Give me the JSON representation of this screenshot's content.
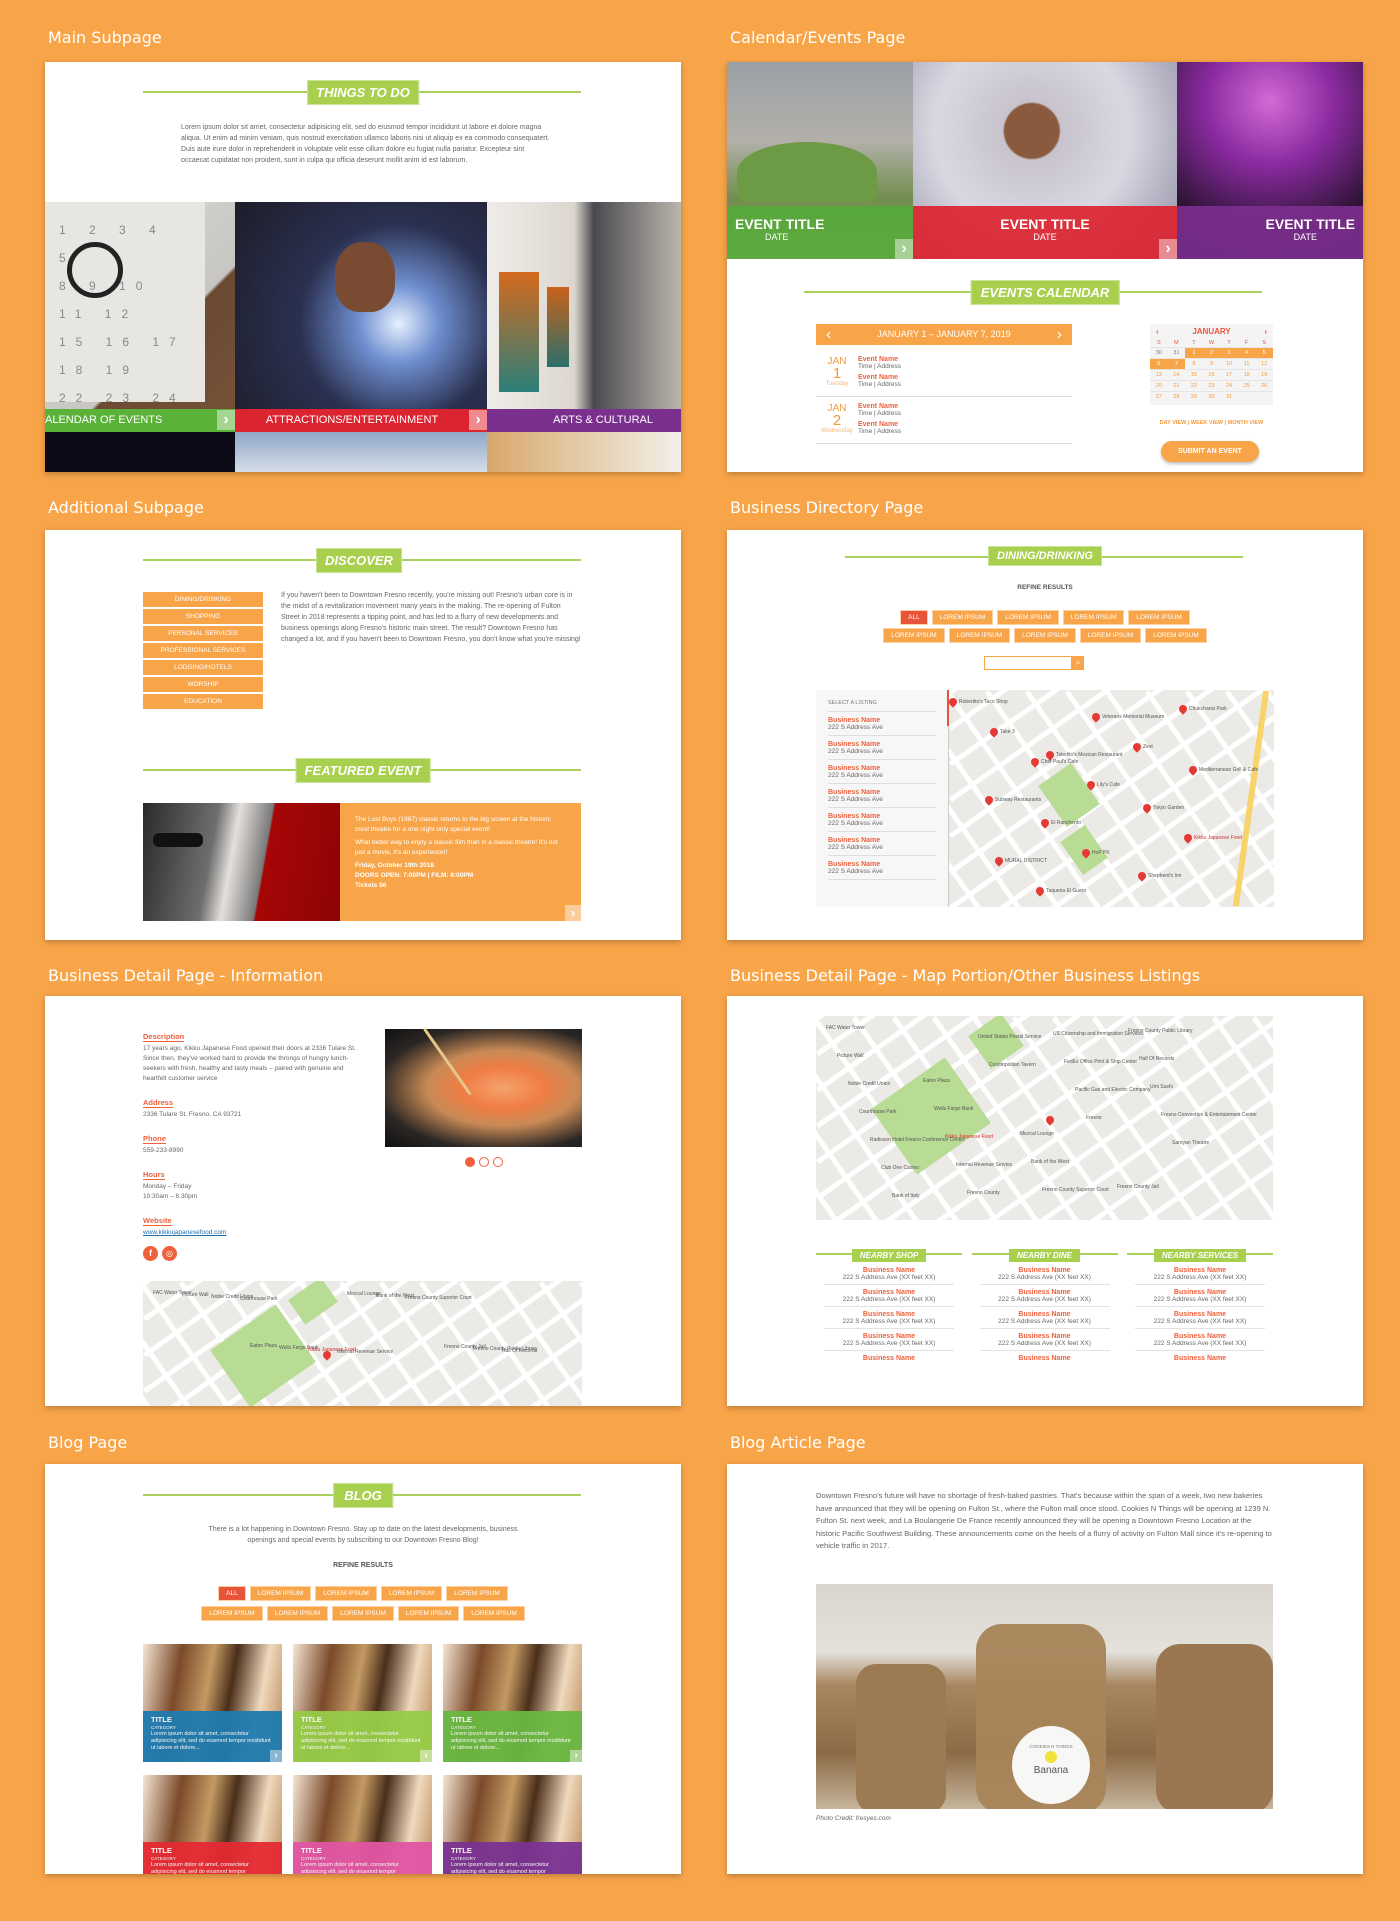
{
  "colors": {
    "orange": "#f8a54a",
    "green": "#a8cf4e",
    "red": "#e8543a",
    "tile_green": "#55a83a",
    "tile_red": "#dc2430",
    "tile_purple": "#7b2f8e",
    "blue": "#1f7bb0"
  },
  "panels": {
    "main_subpage": {
      "title": "Main Subpage",
      "section_label": "THINGS TO DO",
      "intro": "Lorem ipsum dolor sit amet, consectetur adipisicing elit, sed do eiusmod tempor incididunt ut labore et dolore magna aliqua. Ut enim ad minim veniam, quis nostrud exercitation ullamco laboris nisi ut aliquip ex ea commodo consequatert. Duis aute irure dolor in reprehenderit in voluptate velit esse cillum dolore eu fugiat nulla pariatur. Excepteur sint occaecat cupidatat non proident, sunt in culpa qui officia deserunt mollit anim id est laborum.",
      "tiles": [
        {
          "label": "ALENDAR OF EVENTS",
          "icon": "chevron-right-icon"
        },
        {
          "label": "ATTRACTIONS/ENTERTAINMENT",
          "icon": "chevron-right-icon"
        },
        {
          "label": "ARTS & CULTURAL"
        }
      ]
    },
    "calendar_page": {
      "title": "Calendar/Events Page",
      "events": [
        {
          "title": "EVENT TITLE",
          "date": "DATE"
        },
        {
          "title": "EVENT TITLE",
          "date": "DATE"
        },
        {
          "title": "EVENT TITLE",
          "date": "DATE"
        }
      ],
      "section_label": "EVENTS CALENDAR",
      "week_range": "JANUARY 1 – JANUARY 7, 2019",
      "days": [
        {
          "month": "JAN",
          "day": "1",
          "weekday": "Tuesday",
          "items": [
            {
              "name": "Event Name",
              "meta": "Time | Address"
            },
            {
              "name": "Event Name",
              "meta": "Time | Address"
            }
          ]
        },
        {
          "month": "JAN",
          "day": "2",
          "weekday": "Wednesday",
          "items": [
            {
              "name": "Event Name",
              "meta": "Time | Address"
            },
            {
              "name": "Event Name",
              "meta": "Time | Address"
            }
          ]
        }
      ],
      "mini_cal": {
        "month": "JANUARY",
        "weekdays": [
          "S",
          "M",
          "T",
          "W",
          "T",
          "F",
          "S"
        ],
        "weeks": [
          [
            "30",
            "31",
            "1",
            "2",
            "3",
            "4",
            "5"
          ],
          [
            "6",
            "7",
            "8",
            "9",
            "10",
            "11",
            "12"
          ],
          [
            "13",
            "14",
            "15",
            "16",
            "17",
            "18",
            "19"
          ],
          [
            "20",
            "21",
            "22",
            "23",
            "24",
            "25",
            "26"
          ],
          [
            "27",
            "28",
            "29",
            "30",
            "31",
            "",
            ""
          ]
        ],
        "selected": [
          "1",
          "2",
          "3",
          "4",
          "5",
          "6",
          "7"
        ]
      },
      "view_links": [
        "DAY VIEW",
        "WEEK VIEW",
        "MONTH VIEW"
      ],
      "submit_label": "SUBMIT AN EVENT"
    },
    "additional_subpage": {
      "title": "Additional Subpage",
      "section_label": "DISCOVER",
      "menu": [
        "DINING/DRINKING",
        "SHOPPING",
        "PERSONAL SERVICES",
        "PROFESSIONAL SERVICES",
        "LODGING/HOTELS",
        "WORSHIP",
        "EDUCATION"
      ],
      "body": "If you haven't been to Downtown Fresno recently, you're missing out! Fresno's urban core is in the midst of a revitalization movement many years in the making. The re-opening of Fulton Street in 2018 represents a tipping point, and has led to a flurry of new developments and business openings along Fresno's historic main street. The result? Downtown Fresno has changed a lot, and if you haven't been to Downtown Fresno, you don't know what you're missing!",
      "featured_label": "FEATURED EVENT",
      "featured": {
        "p1": "The Lost Boys (1987) classic returns to the big screen at the historic crest theatre for a one night only special event!",
        "p2": "What better way to enjoy a classic film than in a classic theatre! It's not just a movie, it's an experience!!",
        "date": "Friday, October 19th 2018",
        "times": "DOORS OPEN: 7:00PM | FILM: 8:00PM",
        "tickets": "Tickets $6"
      }
    },
    "directory_page": {
      "title": "Business Directory Page",
      "section_label": "DINING/DRINKING",
      "refine_label": "REFINE RESULTS",
      "chips_row1": [
        "ALL",
        "LOREM IPSUM",
        "LOREM IPSUM",
        "LOREM IPSUM",
        "LOREM IPSUM"
      ],
      "chips_row2": [
        "LOREM IPSUM",
        "LOREM IPSUM",
        "LOREM IPSUM",
        "LOREM IPSUM",
        "LOREM IPSUM"
      ],
      "search_placeholder": "",
      "list_header": "SELECT A LISTING",
      "listings": [
        {
          "name": "Business Name",
          "addr": "222 S Address Ave"
        },
        {
          "name": "Business Name",
          "addr": "222 S Address Ave"
        },
        {
          "name": "Business Name",
          "addr": "222 S Address Ave"
        },
        {
          "name": "Business Name",
          "addr": "222 S Address Ave"
        },
        {
          "name": "Business Name",
          "addr": "222 S Address Ave"
        },
        {
          "name": "Business Name",
          "addr": "222 S Address Ave"
        },
        {
          "name": "Business Name",
          "addr": "222 S Address Ave"
        }
      ],
      "map_labels": [
        "Robertito's Taco Shop",
        "Toledito's Mexican Restaurant",
        "Tokyo Garden",
        "MURAL DISTRICT",
        "Veterans Memorial Museum",
        "Mediterranean Grill & Cafe",
        "El Rancherito",
        "Shepherd's Inn",
        "Take 3",
        "Lily's Cafe",
        "Kikku Japanese Food",
        "Taqueria El Guero",
        "Zest",
        "Subway Restaurants",
        "HoP PK",
        "Chukchansi Park",
        "Chef Paul's Cafe"
      ]
    },
    "detail_info_page": {
      "title": "Business Detail Page - Information",
      "fields": [
        {
          "label": "Description",
          "value": "17 years ago, Kikku Japanese Food opened their doors at 2336 Tulare St. Since then, they've worked hard to provide the throngs of hungry lunch-seekers with fresh, healthy and tasty meals – paired with genuine and heartfelt customer service"
        },
        {
          "label": "Address",
          "value": "2336 Tulare St. Fresno, CA 93721"
        },
        {
          "label": "Phone",
          "value": "559-233-8990"
        },
        {
          "label": "Hours",
          "value": "Monday – Friday\n10:30am – 6:30pm"
        },
        {
          "label": "Website",
          "value": "www.kikkujapanesefood.com"
        }
      ],
      "carousel": {
        "count": 3,
        "active": 1
      },
      "social": [
        "facebook-icon",
        "instagram-icon"
      ]
    },
    "detail_map_page": {
      "title": "Business Detail Page - Map Portion/Other Business Listings",
      "map_labels": [
        "FAC Water Tower",
        "Eaton Plaza",
        "Mezcal Lounge",
        "Fresno County Jail",
        "Picture Wall",
        "Wells Fargo Bank",
        "Bank of the West",
        "Fresno County Public Library",
        "Noble Credit Union",
        "Kikku Japanese Food",
        "Fresno County Superior Court",
        "Hall Of Records",
        "Courthouse Park",
        "Internal Revenue Service",
        "US Citizenship and Immigration Services",
        "Umi Sushi",
        "Radisson Hotel Fresno Conference Center",
        "Fresno County",
        "FedEx Office Print & Ship Center",
        "Fresno Convention & Entertainment Center",
        "Club One Casino",
        "United States Postal Service",
        "Pacific Gas and Electric Company",
        "Saroyan Theatre",
        "Bank of Italy",
        "Cosmopolitan Tavern",
        "Fresno"
      ],
      "columns": [
        {
          "label": "NEARBY SHOP",
          "items": [
            {
              "name": "Business Name",
              "addr": "222 S Address Ave (XX feet XX)"
            },
            {
              "name": "Business Name",
              "addr": "222 S Address Ave (XX feet XX)"
            },
            {
              "name": "Business Name",
              "addr": "222 S Address Ave (XX feet XX)"
            },
            {
              "name": "Business Name",
              "addr": "222 S Address Ave (XX feet XX)"
            },
            {
              "name": "Business Name",
              "addr": ""
            }
          ]
        },
        {
          "label": "NEARBY DINE",
          "items": [
            {
              "name": "Business Name",
              "addr": "222 S Address Ave (XX feet XX)"
            },
            {
              "name": "Business Name",
              "addr": "222 S Address Ave (XX feet XX)"
            },
            {
              "name": "Business Name",
              "addr": "222 S Address Ave (XX feet XX)"
            },
            {
              "name": "Business Name",
              "addr": "222 S Address Ave (XX feet XX)"
            },
            {
              "name": "Business Name",
              "addr": ""
            }
          ]
        },
        {
          "label": "NEARBY SERVICES",
          "items": [
            {
              "name": "Business Name",
              "addr": "222 S Address Ave (XX feet XX)"
            },
            {
              "name": "Business Name",
              "addr": "222 S Address Ave (XX feet XX)"
            },
            {
              "name": "Business Name",
              "addr": "222 S Address Ave (XX feet XX)"
            },
            {
              "name": "Business Name",
              "addr": "222 S Address Ave (XX feet XX)"
            },
            {
              "name": "Business Name",
              "addr": ""
            }
          ]
        }
      ]
    },
    "blog_page": {
      "title": "Blog Page",
      "section_label": "BLOG",
      "intro": "There is a lot happening in Downtown Fresno. Stay up to date on the latest developments, business openings and special events by subscribing to our Downtown Fresno Blog!",
      "refine_label": "REFINE RESULTS",
      "chips_row1": [
        "ALL",
        "LOREM IPSUM",
        "LOREM IPSUM",
        "LOREM IPSUM",
        "LOREM IPSUM"
      ],
      "chips_row2": [
        "LOREM IPSUM",
        "LOREM IPSUM",
        "LOREM IPSUM",
        "LOREM IPSUM",
        "LOREM IPSUM"
      ],
      "cards": [
        {
          "title": "TITLE",
          "category": "CATEGORY",
          "excerpt": "Lorem ipsum dolor sit amet, consectetur adipisicing elit, sed do eiusmod tempor incididunt ut labore et dolore...",
          "color": "#1f7bb0"
        },
        {
          "title": "TITLE",
          "category": "CATEGORY",
          "excerpt": "Lorem ipsum dolor sit amet, consectetur adipisicing elit, sed do eiusmod tempor incididunt ut labore et dolore...",
          "color": "#96cc48"
        },
        {
          "title": "TITLE",
          "category": "CATEGORY",
          "excerpt": "Lorem ipsum dolor sit amet, consectetur adipisicing elit, sed do eiusmod tempor incididunt ut labore et dolore...",
          "color": "#6ab842"
        },
        {
          "title": "TITLE",
          "category": "CATEGORY",
          "excerpt": "Lorem ipsum dolor sit amet, consectetur adipisicing elit, sed do eiusmod tempor",
          "color": "#e52a33"
        },
        {
          "title": "TITLE",
          "category": "CATEGORY",
          "excerpt": "Lorem ipsum dolor sit amet, consectetur adipisicing elit, sed do eiusmod tempor",
          "color": "#e255a4"
        },
        {
          "title": "TITLE",
          "category": "CATEGORY",
          "excerpt": "Lorem ipsum dolor sit amet, consectetur adipisicing elit, sed do eiusmod tempor",
          "color": "#7b3393"
        }
      ]
    },
    "blog_article_page": {
      "title": "Blog Article Page",
      "body": "Downtown Fresno's future will have no shortage of fresh-baked pastries. That's because within the span of a week, two new bakeries have announced that they will be opening on Fulton St., where the Fulton mall once stood. Cookies N Things will be opening at 1239 N. Fulton St. next week, and La Boulangerie De France recently announced they will be opening a Downtown Fresno Location at the historic Pacific Southwest Building. These announcements come on the heels of a flurry of activity on Fulton Mall since it's re-opening to vehicle traffic in 2017.",
      "label_brand": "COOKIES N THINGS",
      "label_flavor": "Banana",
      "photo_credit": "Photo Credit: fresyes.com"
    }
  }
}
